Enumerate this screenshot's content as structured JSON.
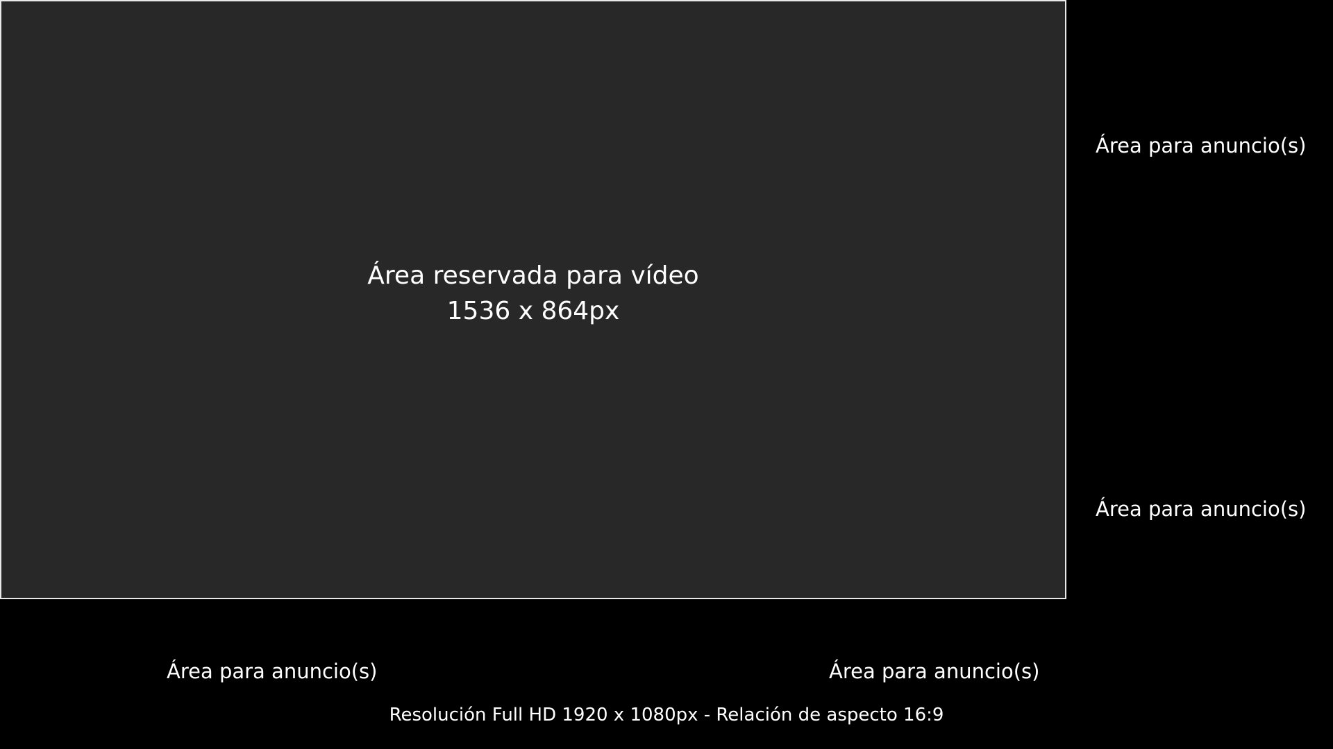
{
  "video": {
    "title": "Área reservada para vídeo",
    "size": "1536 x 864px"
  },
  "ads": {
    "right_top": "Área para anuncio(s)",
    "right_bottom": "Área para anuncio(s)",
    "bottom_left": "Área para anuncio(s)",
    "bottom_right": "Área para anuncio(s)"
  },
  "footer": {
    "caption": "Resolución Full HD 1920 x 1080px - Relación de aspecto 16:9"
  },
  "colors": {
    "background": "#000000",
    "video_fill": "#282828",
    "video_border": "#e9e9e9",
    "text": "#ffffff"
  }
}
